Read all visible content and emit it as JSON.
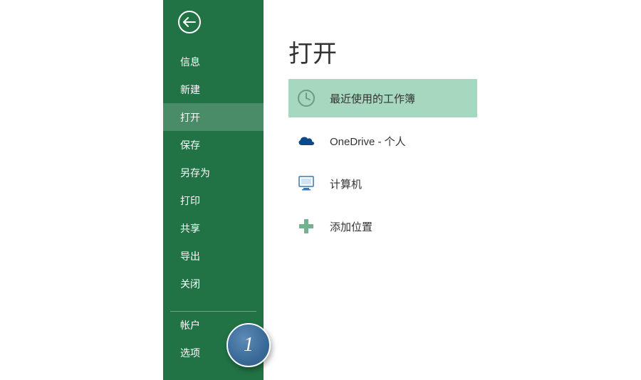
{
  "sidebar": {
    "items": [
      {
        "label": "信息"
      },
      {
        "label": "新建"
      },
      {
        "label": "打开",
        "selected": true
      },
      {
        "label": "保存"
      },
      {
        "label": "另存为"
      },
      {
        "label": "打印"
      },
      {
        "label": "共享"
      },
      {
        "label": "导出"
      },
      {
        "label": "关闭"
      }
    ],
    "footer_items": [
      {
        "label": "帐户"
      },
      {
        "label": "选项"
      }
    ]
  },
  "main": {
    "title": "打开",
    "locations": [
      {
        "label": "最近使用的工作簿",
        "icon": "clock-icon",
        "selected": true
      },
      {
        "label": "OneDrive - 个人",
        "icon": "cloud-icon"
      },
      {
        "label": "计算机",
        "icon": "computer-icon"
      },
      {
        "label": "添加位置",
        "icon": "plus-icon"
      }
    ]
  },
  "annotation": {
    "label": "1"
  },
  "colors": {
    "brand": "#217346",
    "selected_loc_bg": "#a5d8be",
    "annotation_bg": "#3a6a98"
  }
}
